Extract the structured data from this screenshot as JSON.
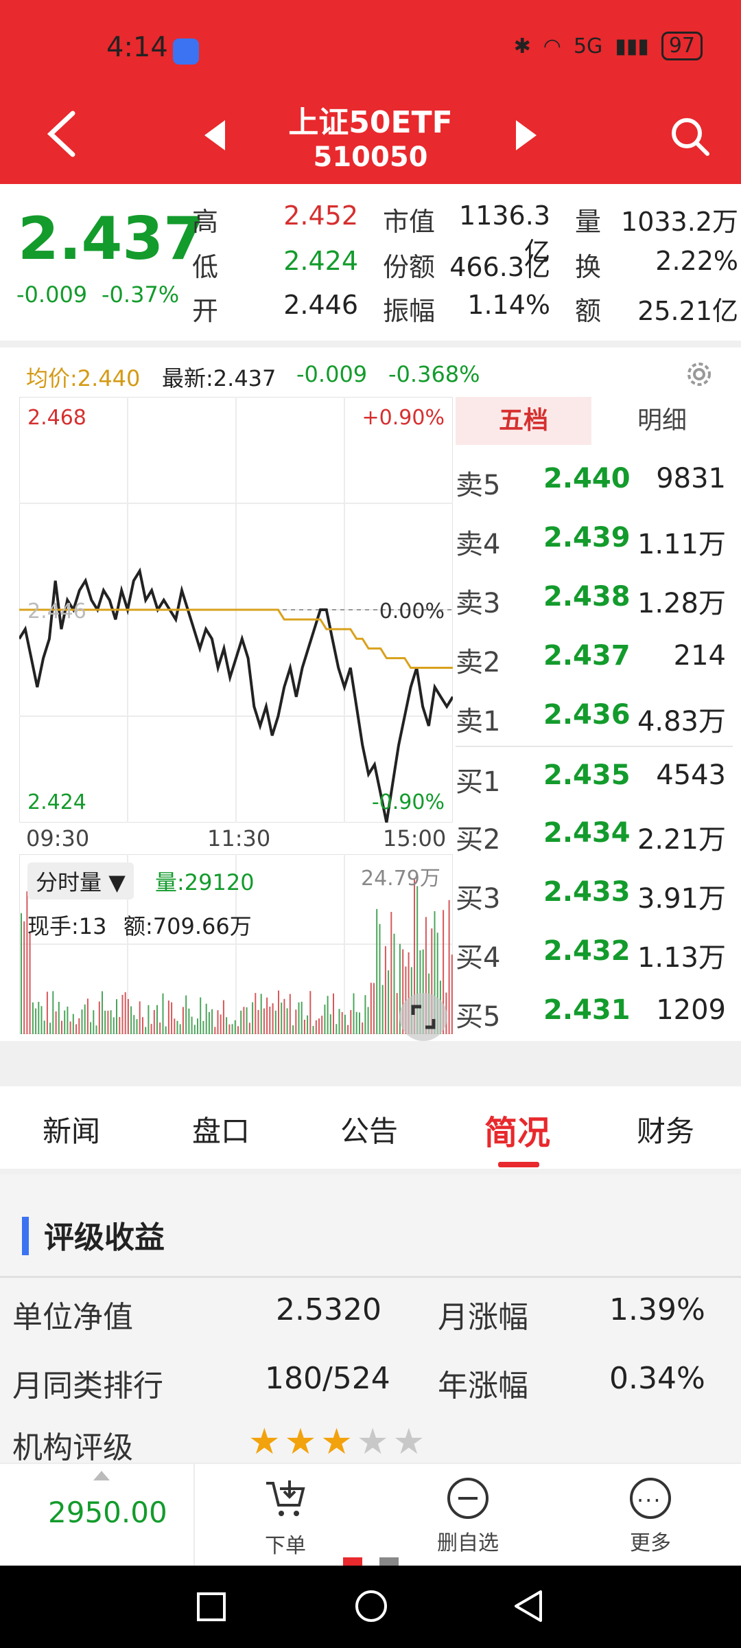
{
  "status": {
    "time": "4:14",
    "battery": "97",
    "network": "5G"
  },
  "header": {
    "title": "上证50ETF",
    "code": "510050"
  },
  "quote": {
    "price": "2.437",
    "change": "-0.009",
    "change_pct": "-0.37%",
    "high_label": "高",
    "high": "2.452",
    "low_label": "低",
    "low": "2.424",
    "open_label": "开",
    "open": "2.446",
    "mcap_label": "市值",
    "mcap": "1136.3亿",
    "shares_label": "份额",
    "shares": "466.3亿",
    "amp_label": "振幅",
    "amp": "1.14%",
    "vol_label": "量",
    "vol": "1033.2万",
    "turn_label": "换",
    "turn": "2.22%",
    "amt_label": "额",
    "amt": "25.21亿"
  },
  "chartinfo": {
    "avg": "均价:2.440",
    "latest": "最新:2.437",
    "chg": "-0.009",
    "pct": "-0.368%"
  },
  "chart_data": {
    "type": "line",
    "ylim": [
      2.424,
      2.468
    ],
    "top_label": "2.468",
    "bottom_label": "2.424",
    "top_pct": "+0.90%",
    "bottom_pct": "-0.90%",
    "mid_pct": "0.00%",
    "mid_price": "2.446",
    "x_labels": [
      "09:30",
      "11:30",
      "15:00"
    ],
    "series": [
      {
        "values": [
          2.443,
          2.444,
          2.441,
          2.438,
          2.441,
          2.443,
          2.449,
          2.444,
          2.447,
          2.446,
          2.448,
          2.449,
          2.447,
          2.446,
          2.448,
          2.447,
          2.445,
          2.448,
          2.446,
          2.449,
          2.45,
          2.447,
          2.448,
          2.446,
          2.447,
          2.446,
          2.445,
          2.448,
          2.446,
          2.444,
          2.442,
          2.444,
          2.443,
          2.44,
          2.442,
          2.439,
          2.441,
          2.443,
          2.441,
          2.436,
          2.434,
          2.436,
          2.433,
          2.435,
          2.438,
          2.44,
          2.437,
          2.44,
          2.442,
          2.444,
          2.446,
          2.446,
          2.443,
          2.44,
          2.438,
          2.44,
          2.436,
          2.432,
          2.429,
          2.43,
          2.427,
          2.424,
          2.428,
          2.432,
          2.435,
          2.438,
          2.44,
          2.436,
          2.434,
          2.438,
          2.437,
          2.436,
          2.437
        ]
      },
      {
        "values": [
          2.446,
          2.446,
          2.446,
          2.446,
          2.446,
          2.446,
          2.446,
          2.446,
          2.446,
          2.446,
          2.446,
          2.446,
          2.446,
          2.446,
          2.446,
          2.446,
          2.446,
          2.446,
          2.446,
          2.446,
          2.446,
          2.446,
          2.446,
          2.446,
          2.446,
          2.446,
          2.446,
          2.446,
          2.446,
          2.446,
          2.446,
          2.446,
          2.446,
          2.446,
          2.446,
          2.446,
          2.446,
          2.446,
          2.446,
          2.446,
          2.446,
          2.446,
          2.446,
          2.446,
          2.445,
          2.445,
          2.445,
          2.445,
          2.445,
          2.445,
          2.445,
          2.444,
          2.444,
          2.444,
          2.444,
          2.444,
          2.443,
          2.443,
          2.442,
          2.442,
          2.442,
          2.441,
          2.441,
          2.441,
          2.441,
          2.44,
          2.44,
          2.44,
          2.44,
          2.44,
          2.44,
          2.44,
          2.44
        ]
      }
    ],
    "volume_labels": {
      "selector": "分时量",
      "vol": "量:29120",
      "max": "24.79万",
      "now": "现手:13",
      "amt": "额:709.66万"
    }
  },
  "orderbook": {
    "tab_active": "五档",
    "tab_other": "明细",
    "rows": [
      {
        "k": "卖5",
        "p": "2.440",
        "v": "9831"
      },
      {
        "k": "卖4",
        "p": "2.439",
        "v": "1.11万"
      },
      {
        "k": "卖3",
        "p": "2.438",
        "v": "1.28万"
      },
      {
        "k": "卖2",
        "p": "2.437",
        "v": "214"
      },
      {
        "k": "卖1",
        "p": "2.436",
        "v": "4.83万"
      },
      {
        "k": "买1",
        "p": "2.435",
        "v": "4543"
      },
      {
        "k": "买2",
        "p": "2.434",
        "v": "2.21万"
      },
      {
        "k": "买3",
        "p": "2.433",
        "v": "3.91万"
      },
      {
        "k": "买4",
        "p": "2.432",
        "v": "1.13万"
      },
      {
        "k": "买5",
        "p": "2.431",
        "v": "1209"
      }
    ]
  },
  "tabs": [
    "新闻",
    "盘口",
    "公告",
    "简况",
    "财务"
  ],
  "section": {
    "title": "评级收益",
    "rows": [
      {
        "label": "单位净值",
        "value": "2.5320",
        "label2": "月涨幅",
        "value2": "1.39%"
      },
      {
        "label": "月同类排行",
        "value": "180/524",
        "label2": "年涨幅",
        "value2": "0.34%"
      }
    ],
    "rating_label": "机构评级",
    "rating": 3
  },
  "bottom": {
    "price": "2950.00",
    "order": "下单",
    "remove": "删自选",
    "more": "更多"
  }
}
